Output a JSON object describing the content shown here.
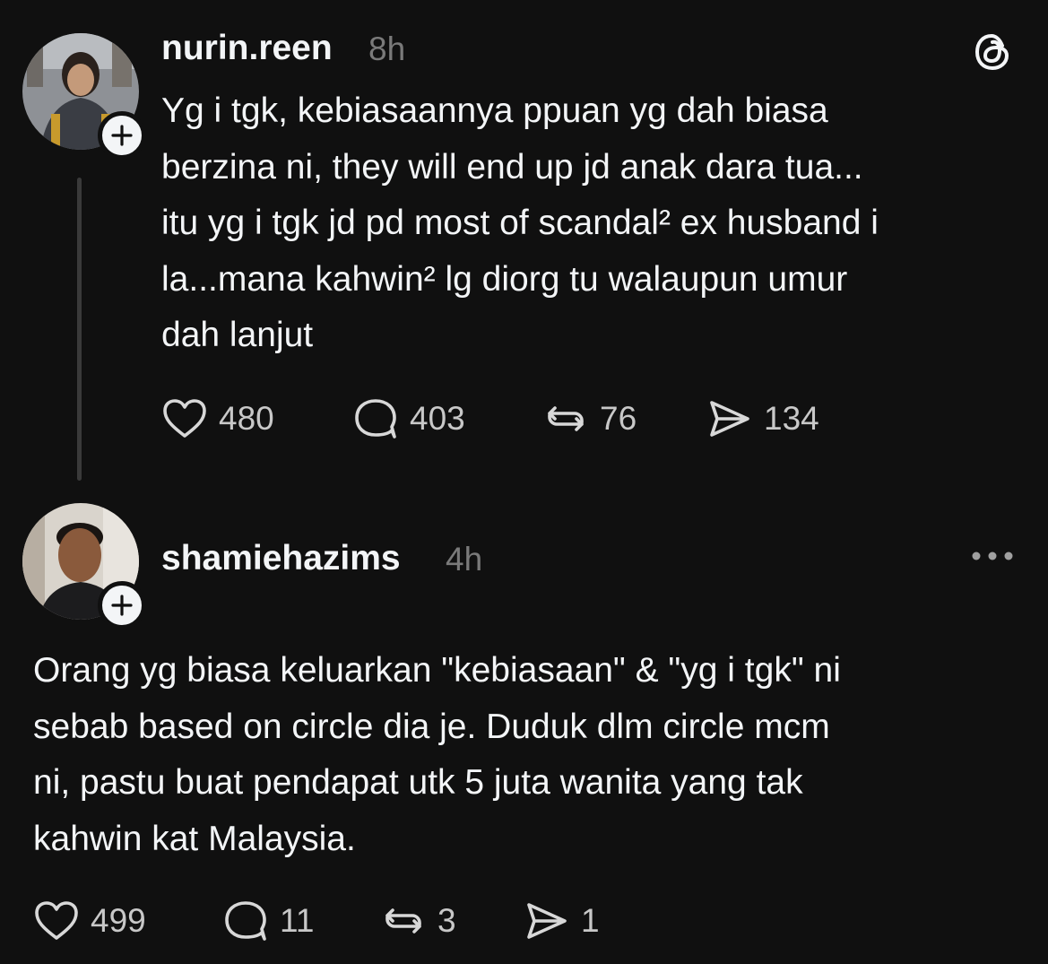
{
  "posts": [
    {
      "username": "nurin.reen",
      "time": "8h",
      "text": "Yg i tgk, kebiasaannya ppuan yg dah biasa\nberzina ni, they will end up jd anak dara tua...\nitu yg i tgk jd pd most of scandal² ex husband i\nla...mana kahwin² lg diorg tu walaupun umur\ndah lanjut",
      "likes": "480",
      "replies": "403",
      "reposts": "76",
      "shares": "134"
    },
    {
      "username": "shamiehazims",
      "time": "4h",
      "text": "Orang yg biasa keluarkan \"kebiasaan\" & \"yg i tgk\" ni\nsebab based on circle dia je. Duduk dlm circle mcm\nni, pastu buat pendapat utk 5 juta wanita yang tak\nkahwin kat Malaysia.",
      "likes": "499",
      "replies": "11",
      "reposts": "3",
      "shares": "1"
    }
  ],
  "icons": {
    "brand": "threads-logo-icon",
    "more": "more-options-icon",
    "like": "heart-icon",
    "reply": "comment-icon",
    "repost": "repost-icon",
    "share": "share-icon",
    "follow": "plus-icon"
  }
}
